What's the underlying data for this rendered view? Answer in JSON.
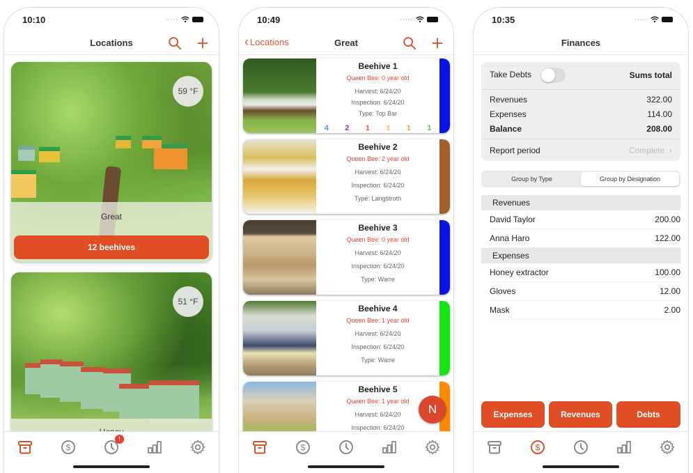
{
  "colors": {
    "accent": "#e04e26",
    "tab_inactive": "#8a8a8a",
    "queen_text": "#ee4433"
  },
  "screens": [
    {
      "status": {
        "time": "10:10"
      },
      "navbar": {
        "title": "Locations",
        "search_icon": "search-icon",
        "add_icon": "plus-icon"
      },
      "locations": [
        {
          "name": "Great",
          "temperature": "59 °F",
          "hive_count_label": "12 beehives"
        },
        {
          "name": "Honey",
          "temperature": "51 °F"
        }
      ],
      "tabbar": {
        "active": "apiaries",
        "items": [
          {
            "name": "apiaries",
            "icon": "archive-box-icon"
          },
          {
            "name": "finances",
            "icon": "dollar-circle-icon"
          },
          {
            "name": "reminders",
            "icon": "clock-icon",
            "badge": "!"
          },
          {
            "name": "statistics",
            "icon": "bar-chart-icon"
          },
          {
            "name": "settings",
            "icon": "gear-icon"
          }
        ]
      }
    },
    {
      "status": {
        "time": "10:49"
      },
      "navbar": {
        "back_label": "Locations",
        "title": "Great"
      },
      "hives": [
        {
          "name": "Beehive 1",
          "queen": "Queen Bee: 0 year old",
          "harvest": "Harvest: 6/24/20",
          "inspection": "Inspection: 6/24/20",
          "type": "Type: Top Bar",
          "color": "#0a14e6",
          "counts": [
            {
              "value": "4",
              "color": "#4a8fe0"
            },
            {
              "value": "2",
              "color": "#9b30b0"
            },
            {
              "value": "1",
              "color": "#e5604a"
            },
            {
              "value": "1",
              "color": "#f2c230"
            },
            {
              "value": "1",
              "color": "#f0a040"
            },
            {
              "value": "1",
              "color": "#6cc44a"
            }
          ]
        },
        {
          "name": "Beehive 2",
          "queen": "Queen Bee: 2 year old",
          "harvest": "Harvest: 6/24/20",
          "inspection": "Inspection: 6/24/20",
          "type": "Type: Langstroth",
          "color": "#a0622a"
        },
        {
          "name": "Beehive 3",
          "queen": "Queen Bee: 0 year old",
          "harvest": "Harvest: 6/24/20",
          "inspection": "Inspection: 6/24/20",
          "type": "Type: Warre",
          "color": "#0a14e6"
        },
        {
          "name": "Beehive 4",
          "queen": "Queen Bee: 1 year old",
          "harvest": "Harvest: 6/24/20",
          "inspection": "Inspection: 6/24/20",
          "type": "Type: Warre",
          "color": "#14e614"
        },
        {
          "name": "Beehive 5",
          "queen": "Queen Bee: 1 year old",
          "harvest": "Harvest: 6/24/20",
          "inspection": "Inspection: 6/24/20",
          "color": "#ff8a00"
        }
      ],
      "fab_label": "N",
      "tabbar": {
        "active": "apiaries"
      }
    },
    {
      "status": {
        "time": "10:35"
      },
      "navbar": {
        "title": "Finances"
      },
      "summary": {
        "take_debts_label": "Take Debts",
        "take_debts_on": false,
        "sums_total_label": "Sums total",
        "rows": [
          {
            "label": "Revenues",
            "value": "322.00"
          },
          {
            "label": "Expenses",
            "value": "114.00"
          },
          {
            "label": "Balance",
            "value": "208.00"
          }
        ],
        "report_period_label": "Report period",
        "report_period_value": "Complete"
      },
      "segments": [
        {
          "label": "Group by Type",
          "active": false
        },
        {
          "label": "Group by Designation",
          "active": true
        }
      ],
      "sections": [
        {
          "header": "Revenues",
          "rows": [
            {
              "label": "David Taylor",
              "value": "200.00"
            },
            {
              "label": "Anna Haro",
              "value": "122.00"
            }
          ]
        },
        {
          "header": "Expenses",
          "rows": [
            {
              "label": "Honey extractor",
              "value": "100.00"
            },
            {
              "label": "Gloves",
              "value": "12.00"
            },
            {
              "label": "Mask",
              "value": "2.00"
            }
          ]
        }
      ],
      "buttons": {
        "expenses": "Expenses",
        "revenues": "Revenues",
        "debts": "Debts"
      },
      "tabbar": {
        "active": "finances"
      }
    }
  ]
}
